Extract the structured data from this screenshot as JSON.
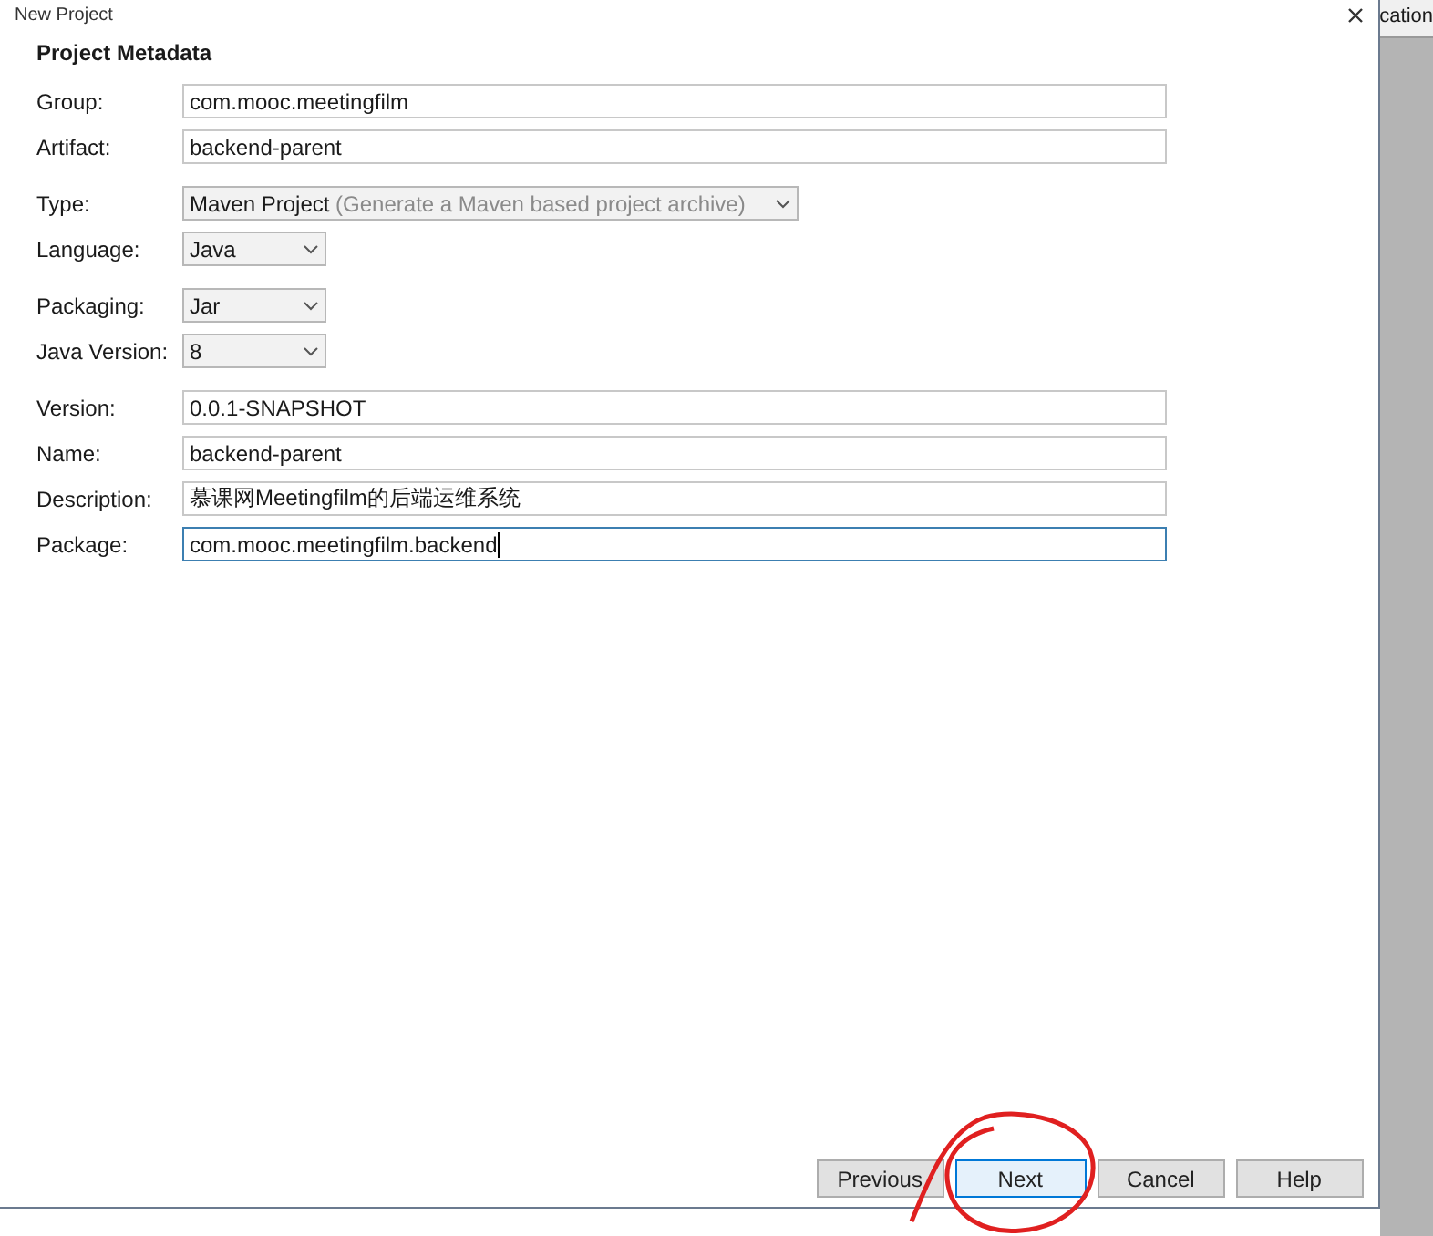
{
  "window": {
    "title": "New Project"
  },
  "background_window": {
    "text": "cation"
  },
  "section_title": "Project Metadata",
  "groups": [
    [
      {
        "label": "Group:",
        "kind": "text",
        "value": "com.mooc.meetingfilm",
        "focused": false
      },
      {
        "label": "Artifact:",
        "kind": "text",
        "value": "backend-parent",
        "focused": false
      }
    ],
    [
      {
        "label": "Type:",
        "kind": "select",
        "value": "Maven Project",
        "hint": "(Generate a Maven based project archive)",
        "wide": true
      },
      {
        "label": "Language:",
        "kind": "select",
        "value": "Java",
        "wide": false
      }
    ],
    [
      {
        "label": "Packaging:",
        "kind": "select",
        "value": "Jar",
        "wide": false
      },
      {
        "label": "Java Version:",
        "kind": "select",
        "value": "8",
        "wide": false
      }
    ],
    [
      {
        "label": "Version:",
        "kind": "text",
        "value": "0.0.1-SNAPSHOT",
        "focused": false
      },
      {
        "label": "Name:",
        "kind": "text",
        "value": "backend-parent",
        "focused": false
      },
      {
        "label": "Description:",
        "kind": "text",
        "value": "慕课网Meetingfilm的后端运维系统",
        "focused": false
      },
      {
        "label": "Package:",
        "kind": "text",
        "value": "com.mooc.meetingfilm.backend",
        "focused": true
      }
    ]
  ],
  "buttons": [
    {
      "label": "Previous",
      "highlighted": false
    },
    {
      "label": "Next",
      "highlighted": true
    },
    {
      "label": "Cancel",
      "highlighted": false
    },
    {
      "label": "Help",
      "highlighted": false
    }
  ]
}
